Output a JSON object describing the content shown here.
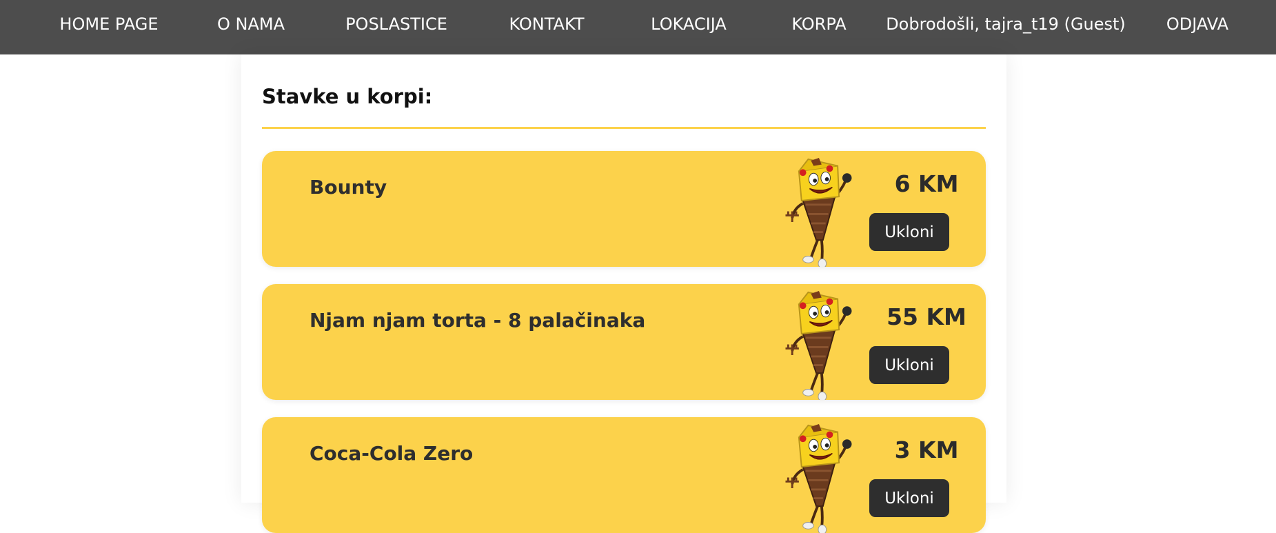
{
  "nav": {
    "items": [
      {
        "label": "HOME PAGE"
      },
      {
        "label": "O NAMA"
      },
      {
        "label": "POSLASTICE"
      },
      {
        "label": "KONTAKT"
      },
      {
        "label": "LOKACIJA"
      },
      {
        "label": "KORPA"
      }
    ],
    "welcome": "Dobrodošli, tajra_t19 (Guest)",
    "logout": "ODJAVA"
  },
  "cart": {
    "title": "Stavke u korpi:",
    "items": [
      {
        "name": "Bounty",
        "price": "6 KM",
        "remove_label": "Ukloni"
      },
      {
        "name": "Njam njam torta - 8 palačinaka",
        "price": "55 KM",
        "remove_label": "Ukloni"
      },
      {
        "name": "Coca-Cola Zero",
        "price": "3 KM",
        "remove_label": "Ukloni"
      }
    ]
  },
  "colors": {
    "navbar_bg": "#4d4d4d",
    "accent_yellow": "#fcd24b",
    "button_dark": "#2e2e2e"
  },
  "icons": {
    "item_image": "chocolate-mascot-icon"
  }
}
